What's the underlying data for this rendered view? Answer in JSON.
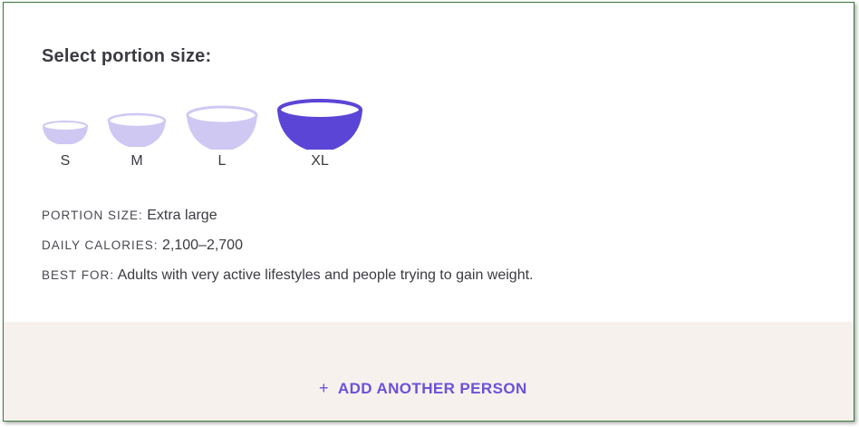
{
  "portion": {
    "title": "Select portion size:",
    "sizes": [
      {
        "label": "S",
        "selected": false
      },
      {
        "label": "M",
        "selected": false
      },
      {
        "label": "L",
        "selected": false
      },
      {
        "label": "XL",
        "selected": true
      }
    ],
    "colors": {
      "selected": "#5b45d6",
      "unselected": "#cfc8f3",
      "accent": "#6a52d8"
    }
  },
  "details": {
    "portion_size_key": "PORTION SIZE:",
    "portion_size_value": "Extra large",
    "daily_calories_key": "DAILY CALORIES:",
    "daily_calories_value": "2,100–2,700",
    "best_for_key": "BEST FOR:",
    "best_for_value": "Adults with very active lifestyles and people trying to gain weight."
  },
  "footer": {
    "plus_icon": "+",
    "add_label": "ADD ANOTHER PERSON"
  }
}
